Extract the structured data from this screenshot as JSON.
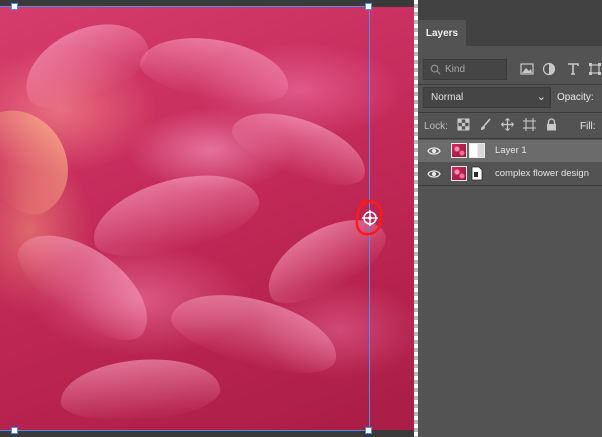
{
  "panel": {
    "active_tab": "Layers",
    "filter_placeholder": "Kind",
    "filter_icons": [
      "image-filter-icon",
      "adjustment-filter-icon",
      "type-filter-icon",
      "shape-filter-icon"
    ],
    "blend_mode": "Normal",
    "opacity_label": "Opacity:",
    "lock_label": "Lock:",
    "lock_icons": [
      "lock-transparent-pixels-icon",
      "lock-image-pixels-icon",
      "lock-position-icon",
      "lock-artboard-icon",
      "lock-all-icon"
    ],
    "fill_label": "Fill:",
    "layers": [
      {
        "name": "Layer 1",
        "selected": true,
        "visible": true
      },
      {
        "name": "complex flower design",
        "selected": false,
        "visible": true
      }
    ]
  },
  "colors": {
    "panel_bg": "#535353",
    "tabbar_bg": "#424242",
    "selected_row": "#6b6b6b",
    "selection_line": "#4b8ef0",
    "annotation_red": "#ff1a1a"
  }
}
